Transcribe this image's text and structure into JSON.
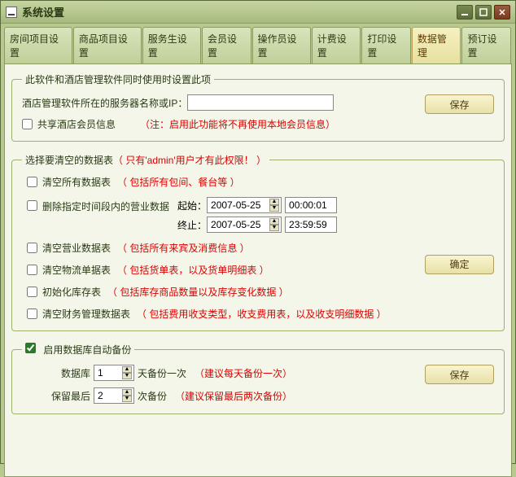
{
  "window": {
    "title": "系统设置"
  },
  "tabs": [
    {
      "label": "房间项目设置"
    },
    {
      "label": "商品项目设置"
    },
    {
      "label": "服务生设置"
    },
    {
      "label": "会员设置"
    },
    {
      "label": "操作员设置"
    },
    {
      "label": "计费设置"
    },
    {
      "label": "打印设置"
    },
    {
      "label": "数据管理"
    },
    {
      "label": "预订设置"
    }
  ],
  "section1": {
    "legend": "此软件和酒店管理软件同时使用时设置此项",
    "server_label": "酒店管理软件所在的服务器名称或IP：",
    "server_value": "",
    "share_label": "共享酒店会员信息",
    "share_note": "（注：启用此功能将不再使用本地会员信息）",
    "save": "保存"
  },
  "section2": {
    "legend": "选择要清空的数据表",
    "legend_note": "（ 只有'admin'用户才有此权限！ ）",
    "clear_all": "清空所有数据表",
    "clear_all_note": "（ 包括所有包间、餐台等 ）",
    "del_range": "删除指定时间段内的营业数据",
    "start_label": "起始：",
    "end_label": "终止：",
    "start_date": "2007-05-25",
    "start_time": "00:00:01",
    "end_date": "2007-05-25",
    "end_time": "23:59:59",
    "clear_biz": "清空营业数据表",
    "clear_biz_note": "（ 包括所有来宾及消费信息 ）",
    "clear_log": "清空物流单据表",
    "clear_log_note": "（ 包括货单表，以及货单明细表 ）",
    "init_stock": "初始化库存表",
    "init_stock_note": "（ 包括库存商品数量以及库存变化数据 ）",
    "clear_fin": "清空财务管理数据表",
    "clear_fin_note": "（ 包括费用收支类型，收支费用表，以及收支明细数据 ）",
    "confirm": "确定"
  },
  "section3": {
    "legend": "启用数据库自动备份",
    "db_label": "数据库",
    "db_value": "1",
    "db_unit": "天备份一次",
    "db_note": "（建议每天备份一次）",
    "keep_label": "保留最后",
    "keep_value": "2",
    "keep_unit": "次备份",
    "keep_note": "（建议保留最后两次备份）",
    "save": "保存"
  }
}
